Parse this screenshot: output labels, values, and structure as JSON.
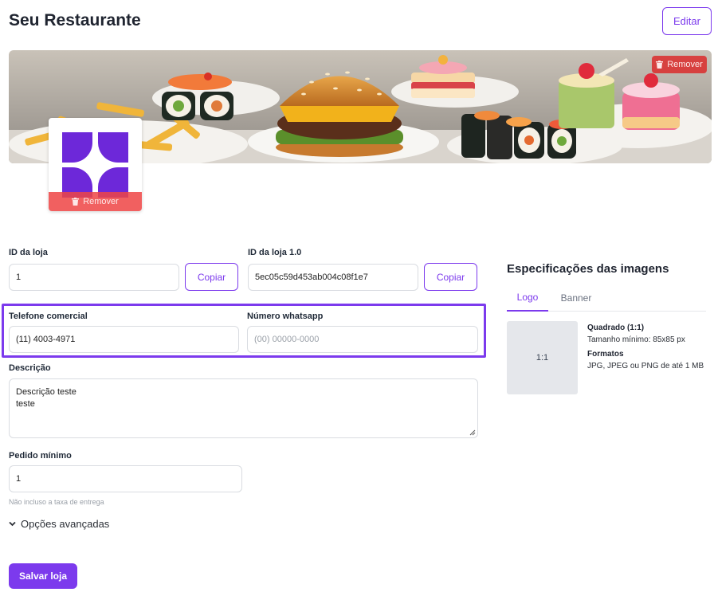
{
  "header": {
    "title": "Seu Restaurante",
    "edit_label": "Editar"
  },
  "banner": {
    "remove_label": "Remover"
  },
  "logo": {
    "remove_label": "Remover"
  },
  "form": {
    "store_id": {
      "label": "ID da loja",
      "value": "1",
      "copy_label": "Copiar"
    },
    "store_id_v1": {
      "label": "ID da loja 1.0",
      "value": "5ec05c59d453ab004c08f1e7",
      "copy_label": "Copiar"
    },
    "business_phone": {
      "label": "Telefone comercial",
      "value": "(11) 4003-4971"
    },
    "whatsapp": {
      "label": "Número whatsapp",
      "placeholder": "(00) 00000-0000"
    },
    "description": {
      "label": "Descrição",
      "line1": "Descrição teste",
      "line2": "teste"
    },
    "min_order": {
      "label": "Pedido mínimo",
      "value": "1",
      "hint": "Não incluso a taxa de entrega"
    },
    "advanced_label": "Opções avançadas",
    "save_label": "Salvar loja"
  },
  "specs": {
    "title": "Especificações das imagens",
    "tabs": [
      {
        "label": "Logo",
        "active": true
      },
      {
        "label": "Banner",
        "active": false
      }
    ],
    "ratio": "1:1",
    "shape_title": "Quadrado (1:1)",
    "min_size": "Tamanho mínimo: 85x85 px",
    "formats_title": "Formatos",
    "formats": "JPG, JPEG ou PNG de até 1 MB"
  },
  "colors": {
    "accent": "#7c3aed",
    "danger": "#ef4444"
  }
}
